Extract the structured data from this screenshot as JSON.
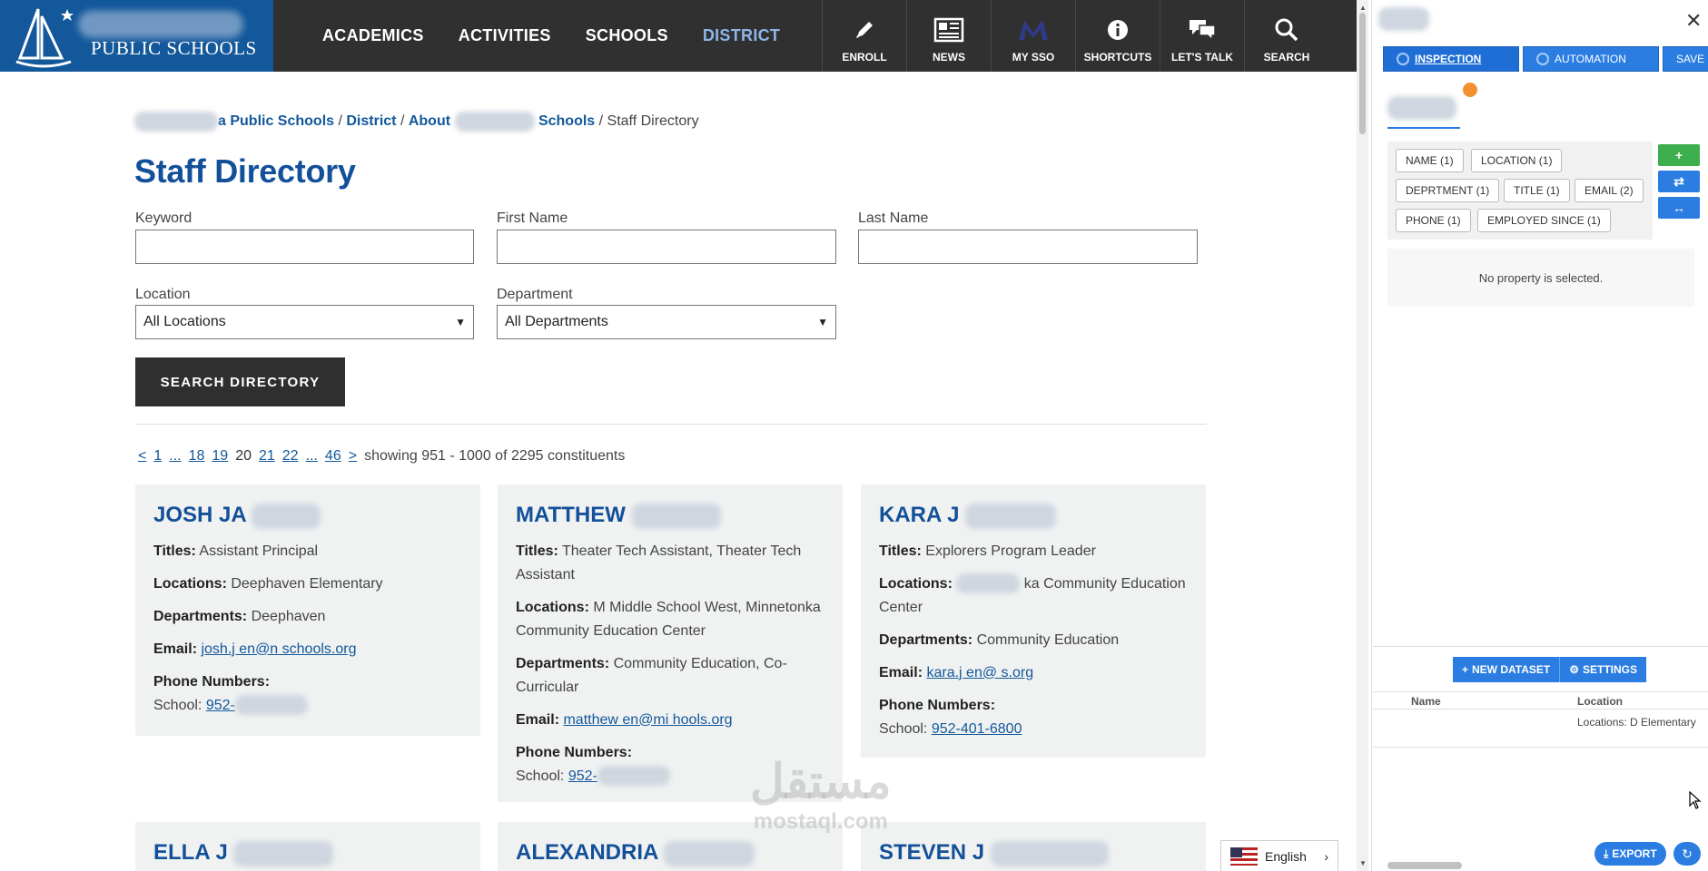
{
  "site": {
    "logo_text": "PUBLIC SCHOOLS",
    "nav": [
      "ACADEMICS",
      "ACTIVITIES",
      "SCHOOLS",
      "DISTRICT"
    ],
    "active_nav": "DISTRICT",
    "util": [
      {
        "label": "ENROLL",
        "icon": "pencil-icon"
      },
      {
        "label": "NEWS",
        "icon": "newspaper-icon"
      },
      {
        "label": "MY SSO",
        "icon": "sso-logo-icon"
      },
      {
        "label": "SHORTCUTS",
        "icon": "info-icon"
      },
      {
        "label": "LET'S TALK",
        "icon": "chat-icon"
      },
      {
        "label": "SEARCH",
        "icon": "search-icon"
      }
    ],
    "breadcrumb": {
      "part1_suffix": "a Public Schools",
      "part2": "District",
      "part3_prefix": "About",
      "part3_suffix": "Schools",
      "current": "Staff Directory"
    },
    "title": "Staff Directory",
    "form": {
      "keyword_label": "Keyword",
      "first_name_label": "First Name",
      "last_name_label": "Last Name",
      "location_label": "Location",
      "location_value": "All Locations",
      "department_label": "Department",
      "department_value": "All Departments",
      "search_button": "SEARCH DIRECTORY"
    },
    "pager": {
      "prev": "<",
      "first": "1",
      "ellipsis1": "...",
      "p18": "18",
      "p19": "19",
      "current": "20",
      "p21": "21",
      "p22": "22",
      "ellipsis2": "...",
      "last": "46",
      "next": ">",
      "summary": "showing 951 - 1000 of 2295 constituents"
    },
    "labels": {
      "titles": "Titles:",
      "locations": "Locations:",
      "departments": "Departments:",
      "email": "Email:",
      "phone": "Phone Numbers:",
      "school": "School:"
    },
    "cards": [
      {
        "name": "JOSH JA",
        "title": "Assistant Principal",
        "location": "Deephaven Elementary",
        "department": "Deephaven",
        "email": "josh.j en@n schools.org",
        "phone": "952-"
      },
      {
        "name": "MATTHEW",
        "title": "Theater Tech Assistant, Theater Tech Assistant",
        "location": "M Middle School West, Minnetonka Community Education Center",
        "department": "Community Education, Co-Curricular",
        "email": "matthew en@mi hools.org",
        "phone": "952-"
      },
      {
        "name": "KARA J",
        "title": "Explorers Program Leader",
        "location": "ka Community Education Center",
        "department": "Community Education",
        "email": "kara.j en@ s.org",
        "phone": "952-401-6800"
      }
    ],
    "next_row_names": [
      "ELLA J",
      "ALEXANDRIA",
      "STEVEN J"
    ],
    "language": "English",
    "watermark": "مستقل",
    "watermark_sub": "mostaql.com"
  },
  "panel": {
    "tabs": [
      "INSPECTION",
      "AUTOMATION",
      "SAVE"
    ],
    "chips": [
      "NAME (1)",
      "LOCATION (1)",
      "DEPRTMENT (1)",
      "TITLE (1)",
      "EMAIL (2)",
      "PHONE (1)",
      "EMPLOYED SINCE (1)"
    ],
    "side_buttons": [
      "+",
      "⇄",
      "↔"
    ],
    "no_property": "No property is selected.",
    "new_dataset": "NEW DATASET",
    "settings": "SETTINGS",
    "table_headers": [
      "Name",
      "Location"
    ],
    "row_location": "Locations: D Elementary",
    "export": "EXPORT",
    "colors": {
      "accent": "#2b7de1",
      "green": "#3dae4e",
      "orange": "#f39132",
      "site_blue": "#13589b"
    }
  }
}
